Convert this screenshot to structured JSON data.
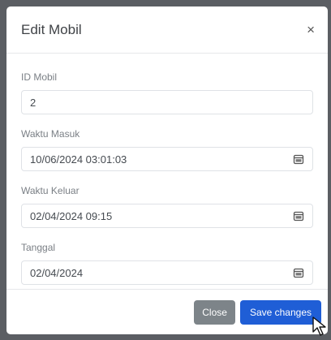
{
  "modal": {
    "title": "Edit Mobil",
    "close_icon": "close-icon"
  },
  "form": {
    "id_mobil": {
      "label": "ID Mobil",
      "value": "2"
    },
    "waktu_masuk": {
      "label": "Waktu Masuk",
      "value": "10/06/2024 03:01:03",
      "icon": "calendar-icon"
    },
    "waktu_keluar": {
      "label": "Waktu Keluar",
      "value": "02/04/2024 09:15",
      "icon": "calendar-icon"
    },
    "tanggal": {
      "label": "Tanggal",
      "value": "02/04/2024",
      "icon": "calendar-icon"
    }
  },
  "footer": {
    "close_label": "Close",
    "save_label": "Save changes"
  },
  "colors": {
    "backdrop": "#5b5e63",
    "primary": "#1f5ed6",
    "secondary": "#7d8489"
  }
}
